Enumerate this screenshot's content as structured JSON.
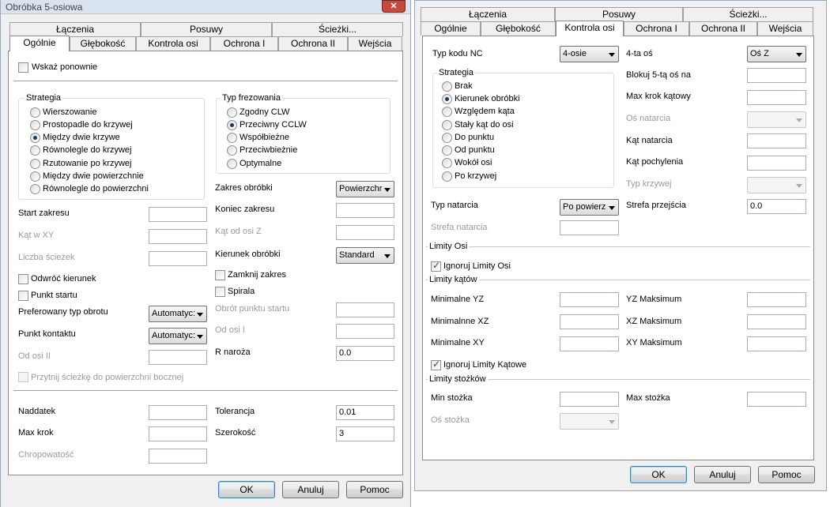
{
  "left_window": {
    "title": "Obróbka 5-osiowa",
    "tabs_row1": [
      "Łączenia",
      "Posuwy",
      "Ścieżki..."
    ],
    "tabs_row2": [
      "Ogólnie",
      "Głębokość",
      "Kontrola osi",
      "Ochrona I",
      "Ochrona II",
      "Wejścia"
    ],
    "wskaz_ponownie": "Wskaż ponownie",
    "strategia": {
      "title": "Strategia",
      "options": [
        "Wierszowanie",
        "Prostopadle do krzywej",
        "Między dwie krzywe",
        "Równolegle do krzywej",
        "Rzutowanie po krzywej",
        "Między dwie powierzchnie",
        "Równolegle do powierzchni"
      ],
      "selected": "Między dwie krzywe"
    },
    "typ_frezowania": {
      "title": "Typ frezowania",
      "options": [
        "Zgodny CLW",
        "Przeciwny CCLW",
        "Współbieżne",
        "Przeciwbieżnie",
        "Optymalne"
      ],
      "selected": "Przeciwny CCLW"
    },
    "zakres_obrobki": {
      "label": "Zakres obróbki",
      "value": "Powierzchr"
    },
    "start_zakresu": {
      "label": "Start zakresu",
      "value": ""
    },
    "koniec_zakresu": {
      "label": "Koniec zakresu",
      "value": ""
    },
    "kat_w_xy": {
      "label": "Kąt w XY",
      "value": ""
    },
    "kat_od_osi_z": {
      "label": "Kąt od osi Z",
      "value": ""
    },
    "liczba_sciezek": {
      "label": "Liczba ścieżek",
      "value": ""
    },
    "kierunek_obrobki": {
      "label": "Kierunek obróbki",
      "value": "Standard"
    },
    "odwroc_kierunek": "Odwróć kierunek",
    "zamknij_zakres": "Zamknij zakres",
    "punkt_startu": "Punkt startu",
    "spirala": "Spirala",
    "preferowany_typ_obrotu": {
      "label": "Preferowany typ obrotu",
      "value": "Automatyc:"
    },
    "obrot_punktu_startu": {
      "label": "Obrót punktu startu",
      "value": ""
    },
    "punkt_kontaktu": {
      "label": "Punkt kontaktu",
      "value": "Automatyc:"
    },
    "od_osi_i": {
      "label": "Od osi I",
      "value": ""
    },
    "od_osi_ii": {
      "label": "Od osi II",
      "value": ""
    },
    "r_naroza": {
      "label": "R naroża",
      "value": "0.0"
    },
    "przytnij": "Przytnij ścieżkę do powierzchni bocznej",
    "naddatek": {
      "label": "Naddatek",
      "value": ""
    },
    "tolerancja": {
      "label": "Tolerancja",
      "value": "0.01"
    },
    "max_krok": {
      "label": "Max krok",
      "value": ""
    },
    "szerokosc": {
      "label": "Szerokość",
      "value": "3"
    },
    "chropowatosc": {
      "label": "Chropowatość",
      "value": ""
    },
    "buttons": {
      "ok": "OK",
      "anuluj": "Anuluj",
      "pomoc": "Pomoc"
    }
  },
  "right_window": {
    "tabs_row1": [
      "Łączenia",
      "Posuwy",
      "Ścieżki..."
    ],
    "tabs_row2": [
      "Ogólnie",
      "Głębokość",
      "Kontrola osi",
      "Ochrona I",
      "Ochrona II",
      "Wejścia"
    ],
    "typ_kodu_nc": {
      "label": "Typ kodu NC",
      "value": "4-osie"
    },
    "czwarta_os": {
      "label": "4-ta oś",
      "value": "Oś Z"
    },
    "strategia": {
      "title": "Strategia",
      "options": [
        "Brak",
        "Kierunek obróbki",
        "Względem kąta",
        "Stały kąt do osi",
        "Do punktu",
        "Od punktu",
        "Wokół osi",
        "Po krzywej"
      ],
      "selected": "Kierunek obróbki"
    },
    "blokuj_5ta_os": {
      "label": "Blokuj 5-tą oś na",
      "value": ""
    },
    "max_krok_katowy": {
      "label": "Max krok kątowy",
      "value": ""
    },
    "os_natarcia": {
      "label": "Oś natarcia",
      "value": ""
    },
    "kat_natarcia": {
      "label": "Kąt natarcia",
      "value": ""
    },
    "kat_pochylenia": {
      "label": "Kąt pochylenia",
      "value": ""
    },
    "typ_krzywej": {
      "label": "Typ krzywej",
      "value": ""
    },
    "typ_natarcia": {
      "label": "Typ natarcia",
      "value": "Po powierz"
    },
    "strefa_przejscia": {
      "label": "Strefa przejścia",
      "value": "0.0"
    },
    "strefa_natarcia": {
      "label": "Strefa natarcia",
      "value": ""
    },
    "limity_osi": "Limity Osi",
    "ignoruj_limity_osi": "Ignoruj Limity Osi",
    "limity_katow": "Limity kątów",
    "min_yz": {
      "label": "Minimalne YZ",
      "value": ""
    },
    "yz_max": {
      "label": "YZ Maksimum",
      "value": ""
    },
    "min_xz": {
      "label": "Minimalnne XZ",
      "value": ""
    },
    "xz_max": {
      "label": "XZ Maksimum",
      "value": ""
    },
    "min_xy": {
      "label": "Minimalne XY",
      "value": ""
    },
    "xy_max": {
      "label": "XY Maksimum",
      "value": ""
    },
    "ignoruj_limity_katowe": "Ignoruj Limity Kątowe",
    "limity_stozkow": "Limity stożków",
    "min_stozka": {
      "label": "Min stożka",
      "value": ""
    },
    "max_stozka": {
      "label": "Max stożka",
      "value": ""
    },
    "os_stozka": {
      "label": "Oś stożka",
      "value": ""
    },
    "buttons": {
      "ok": "OK",
      "anuluj": "Anuluj",
      "pomoc": "Pomoc"
    }
  }
}
